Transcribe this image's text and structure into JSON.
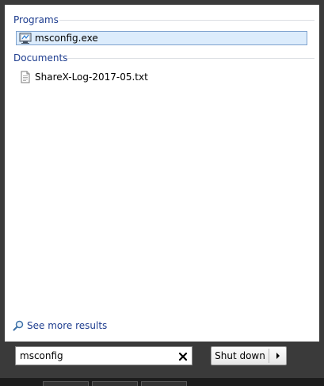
{
  "results": {
    "groups": [
      {
        "title": "Programs",
        "items": [
          {
            "label": "msconfig.exe",
            "icon": "msconfig-app-icon",
            "selected": true
          }
        ]
      },
      {
        "title": "Documents",
        "items": [
          {
            "label": "ShareX-Log-2017-05.txt",
            "icon": "text-file-icon",
            "selected": false
          }
        ]
      }
    ]
  },
  "see_more": {
    "label": "See more results",
    "icon": "search-icon"
  },
  "search": {
    "value": "msconfig",
    "clear_icon": "close-icon"
  },
  "shutdown": {
    "label": "Shut down",
    "arrow_icon": "arrow-right-icon"
  },
  "colors": {
    "group_title": "#1e3d8f",
    "selection_bg": "#dcecfc",
    "selection_border": "#7da2ce",
    "frame": "#3a3a3a"
  }
}
